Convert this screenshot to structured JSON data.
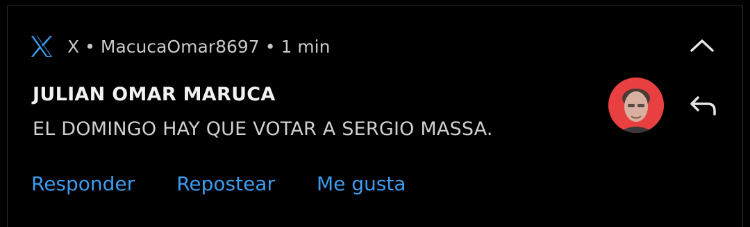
{
  "notification": {
    "app_name": "X",
    "separator": "•",
    "account": "MacucaOmar8697",
    "time": "1 min",
    "title": "JULIAN OMAR MARUCA",
    "message": "EL DOMINGO HAY QUE VOTAR A SERGIO MASSA.",
    "icons": {
      "app": "x-logo-icon",
      "collapse": "chevron-up-icon",
      "reply": "reply-arrow-icon",
      "avatar": "profile-avatar"
    },
    "actions": {
      "reply_label": "Responder",
      "repost_label": "Repostear",
      "like_label": "Me gusta"
    }
  },
  "colors": {
    "background": "#000000",
    "accent": "#3d9df0",
    "title": "#f2f2f2",
    "secondary_text": "#c8c8c8",
    "avatar_bg": "#e84040"
  }
}
